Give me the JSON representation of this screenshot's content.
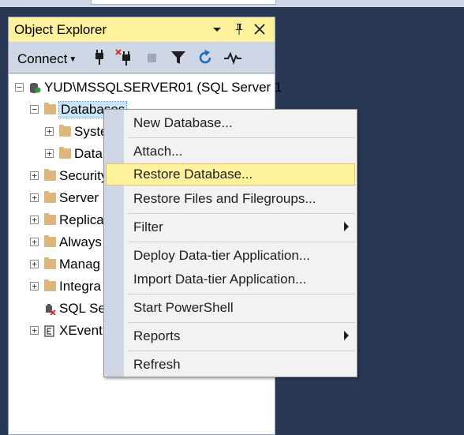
{
  "panel": {
    "title": "Object Explorer",
    "title_icons": [
      "dropdown-arrow-icon",
      "pin-icon",
      "close-icon"
    ],
    "colors": {
      "title_bg": "#fff29d",
      "panel_bg": "#cfd6e5",
      "workspace_bg": "#293955"
    }
  },
  "toolbar": {
    "connect_label": "Connect",
    "tools": [
      "connect-plug-icon",
      "disconnect-plug-icon",
      "stop-icon",
      "filter-icon",
      "refresh-icon",
      "activity-monitor-icon"
    ]
  },
  "tree": {
    "server": "YUD\\MSSQLSERVER01 (SQL Server 1",
    "databases": "Databases",
    "system_databases": "Syste",
    "data_node": "Data",
    "security": "Security",
    "server_objects": "Server",
    "replication": "Replica",
    "always_on": "Always",
    "management": "Manag",
    "integration": "Integra",
    "sql_agent": "SQL Se",
    "xevent": "XEvent"
  },
  "context_menu": {
    "items": [
      {
        "label": "New Database...",
        "submenu": false
      },
      {
        "label": "Attach...",
        "submenu": false
      },
      {
        "label": "Restore Database...",
        "submenu": false,
        "highlighted": true
      },
      {
        "label": "Restore Files and Filegroups...",
        "submenu": false
      },
      {
        "label": "Filter",
        "submenu": true
      },
      {
        "label": "Deploy Data-tier Application...",
        "submenu": false
      },
      {
        "label": "Import Data-tier Application...",
        "submenu": false
      },
      {
        "label": "Start PowerShell",
        "submenu": false
      },
      {
        "label": "Reports",
        "submenu": true
      },
      {
        "label": "Refresh",
        "submenu": false
      }
    ],
    "highlight_color": "#fff29d"
  }
}
